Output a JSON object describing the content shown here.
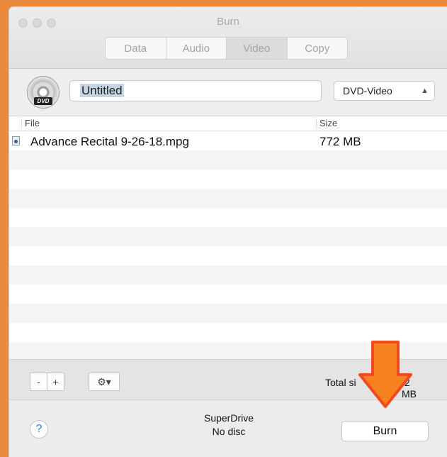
{
  "window": {
    "title": "Burn"
  },
  "tabs": [
    {
      "label": "Data",
      "selected": false
    },
    {
      "label": "Audio",
      "selected": false
    },
    {
      "label": "Video",
      "selected": true
    },
    {
      "label": "Copy",
      "selected": false
    }
  ],
  "disc": {
    "icon": "dvd-disc-icon",
    "badge": "DVD",
    "name_value": "Untitled"
  },
  "format_select": {
    "value": "DVD-Video"
  },
  "list": {
    "columns": {
      "file": "File",
      "size": "Size"
    },
    "rows": [
      {
        "file": "Advance Recital 9-26-18.mpg",
        "size": "772 MB",
        "icon": "video-file-icon"
      }
    ]
  },
  "toolbar": {
    "remove_label": "-",
    "add_label": "+",
    "gear_label": "⚙▾"
  },
  "total": {
    "label": "Total si",
    "value": ".2 MB"
  },
  "footer": {
    "help_label": "?",
    "drive_name": "SuperDrive",
    "drive_status": "No disc",
    "burn_label": "Burn"
  },
  "annotation": {
    "arrow_color": "#f04a1e",
    "arrow_fill": "#f5811f"
  },
  "colors": {
    "frame": "#ea8a3c",
    "help_blue": "#2c7be0"
  }
}
